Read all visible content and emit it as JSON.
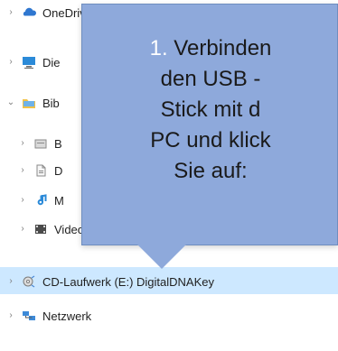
{
  "nav": {
    "onedrive": {
      "label": "OneDrive",
      "icon": "onedrive-icon",
      "chevron": "›"
    },
    "desktop": {
      "label": "Die",
      "icon": "desktop-icon",
      "chevron": "›"
    },
    "libraries": {
      "label": "Bib",
      "icon": "libraries-icon",
      "chevron": "⌄"
    },
    "documents_1": {
      "label": "B",
      "icon": "document-folder-icon",
      "chevron": "›"
    },
    "documents_2": {
      "label": "D",
      "icon": "document-icon",
      "chevron": "›"
    },
    "music": {
      "label": "M",
      "icon": "music-icon",
      "chevron": "›"
    },
    "videos": {
      "label": "Videos",
      "icon": "video-icon",
      "chevron": "›"
    },
    "cdrive": {
      "label": "CD-Laufwerk (E:) DigitalDNAKey",
      "icon": "cd-drive-icon",
      "chevron": "›"
    },
    "network": {
      "label": "Netzwerk",
      "icon": "network-icon",
      "chevron": "›"
    }
  },
  "callout": {
    "step_number": "1.",
    "lines": [
      "Verbinden",
      "den USB -",
      "Stick mit d",
      "PC und klick",
      "Sie auf:"
    ],
    "background_color": "#8ea9db",
    "number_color": "#ffffff"
  }
}
